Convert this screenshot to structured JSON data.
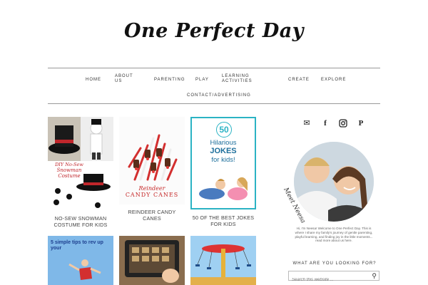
{
  "logo": {
    "text": "One Perfect Day"
  },
  "nav": {
    "items": [
      "HOME",
      "ABOUT US",
      "PARENTING",
      "PLAY",
      "LEARNING ACTIVITIES",
      "CREATE",
      "EXPLORE",
      "CONTACT/ADVERTISING"
    ]
  },
  "posts": [
    {
      "title": "NO-SEW SNOWMAN COSTUME FOR KIDS",
      "image_text": [
        "DIY No-Sew",
        "Snowman Costume"
      ]
    },
    {
      "title": "REINDEER CANDY CANES",
      "image_text": [
        "Reindeer",
        "CANDY CANES"
      ]
    },
    {
      "title": "50 OF THE BEST JOKES FOR KIDS",
      "image_text": [
        "50",
        "Hilarious",
        "JOKES",
        "for kids!"
      ]
    },
    {
      "title": "",
      "image_text": [
        "5 simple tips to rev up your"
      ]
    },
    {
      "title": "",
      "image_text": []
    },
    {
      "title": "",
      "image_text": []
    }
  ],
  "sidebar": {
    "social_icons": [
      "email-icon",
      "facebook-icon",
      "instagram-icon",
      "pinterest-icon"
    ],
    "profile_signature": "Meet Neesa",
    "about_text": "Hi, I'm Neesa! Welcome to One Perfect Day. This is where I share my family's journey of gentle parenting, playful learning, and finding joy in the little moments... read more about us here.",
    "search_heading": "WHAT ARE YOU LOOKING FOR?",
    "search_placeholder": "Search this website ..."
  },
  "colors": {
    "accent": "#2bb3c4",
    "rule": "#999999",
    "text": "#333333"
  }
}
